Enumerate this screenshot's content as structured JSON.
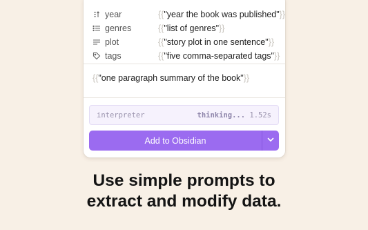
{
  "properties": [
    {
      "name": "year",
      "icon": "year-icon",
      "value": "\"year the book was published\""
    },
    {
      "name": "genres",
      "icon": "list-icon",
      "value": "\"list of genres\""
    },
    {
      "name": "plot",
      "icon": "text-icon",
      "value": "\"story plot in one sentence\""
    },
    {
      "name": "tags",
      "icon": "tag-icon",
      "value": "\"five comma-separated tags\""
    }
  ],
  "braces": {
    "open": "{{",
    "close": "}}"
  },
  "summary": {
    "value": "\"one paragraph summary of the book\""
  },
  "interpreter": {
    "label": "interpreter",
    "status": "thinking...",
    "time": "1.52s"
  },
  "button": {
    "label": "Add to Obsidian"
  },
  "headline": {
    "line1": "Use simple prompts to",
    "line2": "extract and modify data."
  },
  "colors": {
    "accent": "#9b6bf0",
    "background": "#f8f0e6",
    "brace": "#c6c2bb"
  }
}
